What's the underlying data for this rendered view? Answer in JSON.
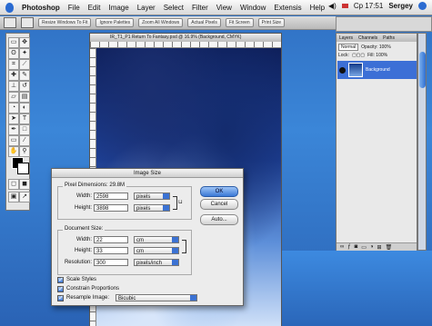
{
  "menubar": {
    "app_name": "Photoshop",
    "menus": [
      "File",
      "Edit",
      "Image",
      "Layer",
      "Select",
      "Filter",
      "View",
      "Window",
      "Extensis",
      "Help"
    ],
    "clock": "Cp 17:51",
    "user": "Sergey"
  },
  "optionsbar": {
    "buttons": [
      "Resize Windows To Fit",
      "Ignore Palettes",
      "Zoom All Windows",
      "Actual Pixels",
      "Fit Screen",
      "Print Size"
    ]
  },
  "document": {
    "title": "IR_T1_P1 Return To Fantasy.psd @ 16.9% (Background, CMYK)"
  },
  "layers": {
    "tabs": [
      "Layers",
      "Channels",
      "Paths"
    ],
    "blend_mode": "Normal",
    "opacity_label": "Opacity: 100%",
    "lock_label": "Lock:",
    "fill_label": "Fill: 100%",
    "layer_name": "Background"
  },
  "dialog": {
    "title": "Image Size",
    "pixel_dimensions": {
      "legend": "Pixel Dimensions: 29.8M",
      "width_label": "Width:",
      "width_value": "2598",
      "width_unit": "pixels",
      "height_label": "Height:",
      "height_value": "3898",
      "height_unit": "pixels"
    },
    "document_size": {
      "legend": "Document Size:",
      "width_label": "Width:",
      "width_value": "22",
      "width_unit": "cm",
      "height_label": "Height:",
      "height_value": "33",
      "height_unit": "cm",
      "resolution_label": "Resolution:",
      "resolution_value": "300",
      "resolution_unit": "pixels/inch"
    },
    "scale_styles": "Scale Styles",
    "constrain": "Constrain Proportions",
    "resample_label": "Resample Image:",
    "resample_value": "Bicubic",
    "ok": "OK",
    "cancel": "Cancel",
    "auto": "Auto..."
  },
  "colors": {
    "accent": "#3b72d3",
    "desktop": "#2f6fc2",
    "canvas_dark": "#0e1f5a",
    "canvas_light": "#cfe0f8"
  },
  "tool_icons": [
    "marquee-icon",
    "move-icon",
    "lasso-icon",
    "magic-wand-icon",
    "crop-icon",
    "slice-icon",
    "healing-icon",
    "brush-icon",
    "stamp-icon",
    "history-brush-icon",
    "eraser-icon",
    "gradient-icon",
    "blur-icon",
    "dodge-icon",
    "path-select-icon",
    "type-icon",
    "pen-icon",
    "shape-icon",
    "notes-icon",
    "eyedropper-icon",
    "hand-icon",
    "zoom-icon"
  ]
}
